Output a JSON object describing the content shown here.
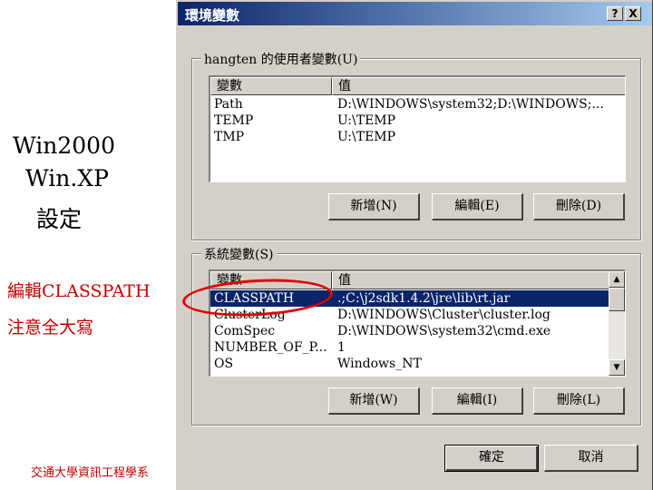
{
  "slide": {
    "os_line_1": "Win2000",
    "os_line_2": "Win.XP",
    "os_line_3": "設定",
    "note_1": "編輯CLASSPATH",
    "note_2": "注意全大寫",
    "footer": "交通大學資訊工程學系"
  },
  "dialog": {
    "title": "環境變數",
    "help_label": "?",
    "close_label": "X",
    "user_group_label": "hangten 的使用者變數(U)",
    "system_group_label": "系統變數(S)",
    "col_variable": "變數",
    "col_value": "值",
    "user_vars": [
      {
        "name": "Path",
        "value": "D:\\WINDOWS\\system32;D:\\WINDOWS;..."
      },
      {
        "name": "TEMP",
        "value": "U:\\TEMP"
      },
      {
        "name": "TMP",
        "value": "U:\\TEMP"
      }
    ],
    "system_vars": [
      {
        "name": "CLASSPATH",
        "value": ".;C:\\j2sdk1.4.2\\jre\\lib\\rt.jar"
      },
      {
        "name": "ClusterLog",
        "value": "D:\\WINDOWS\\Cluster\\cluster.log"
      },
      {
        "name": "ComSpec",
        "value": "D:\\WINDOWS\\system32\\cmd.exe"
      },
      {
        "name": "NUMBER_OF_P...",
        "value": "1"
      },
      {
        "name": "OS",
        "value": "Windows_NT"
      }
    ],
    "selected_system_var": "CLASSPATH",
    "user_buttons": {
      "new": "新增(N)",
      "edit": "編輯(E)",
      "delete": "刪除(D)"
    },
    "system_buttons": {
      "new": "新增(W)",
      "edit": "編輯(I)",
      "delete": "刪除(L)"
    },
    "ok_label": "確定",
    "cancel_label": "取消",
    "scroll_up_icon": "▲",
    "scroll_down_icon": "▼"
  },
  "colors": {
    "selection": "#0a246a",
    "annotation_red": "#c00000",
    "dialog_face": "#d4d0c8"
  }
}
